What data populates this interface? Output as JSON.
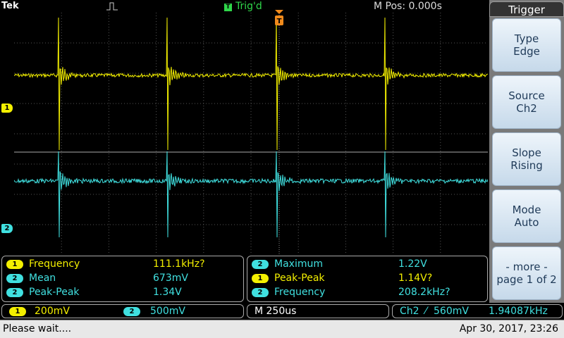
{
  "header": {
    "brand": "Tek",
    "trigger_state_badge": "T",
    "trigger_state": "Trig'd",
    "horizontal_position": "M Pos: 0.000s"
  },
  "screen": {
    "trigger_marker": "T",
    "ch1_marker": "1",
    "ch2_marker": "2"
  },
  "side_menu": {
    "title": "Trigger",
    "buttons": [
      {
        "line1": "Type",
        "line2": "Edge"
      },
      {
        "line1": "Source",
        "line2": "Ch2"
      },
      {
        "line1": "Slope",
        "line2": "Rising"
      },
      {
        "line1": "Mode",
        "line2": "Auto"
      },
      {
        "line1": "- more -",
        "line2": "page 1 of 2"
      }
    ]
  },
  "measurements_left": [
    {
      "ch": "1",
      "name": "Frequency",
      "value": "111.1kHz?"
    },
    {
      "ch": "2",
      "name": "Mean",
      "value": "673mV"
    },
    {
      "ch": "2",
      "name": "Peak-Peak",
      "value": "1.34V"
    }
  ],
  "measurements_right": [
    {
      "ch": "2",
      "name": "Maximum",
      "value": "1.22V"
    },
    {
      "ch": "1",
      "name": "Peak-Peak",
      "value": "1.14V?"
    },
    {
      "ch": "2",
      "name": "Frequency",
      "value": "208.2kHz?"
    }
  ],
  "bottom": {
    "ch1_badge": "1",
    "ch1_scale": "200mV",
    "ch2_badge": "2",
    "ch2_scale": "500mV",
    "timebase": "M 250us",
    "trigger_source": "Ch2",
    "trigger_slope_symbol": "⁄",
    "trigger_level": "560mV",
    "trigger_frequency": "1.94087kHz"
  },
  "status": {
    "message": "Please wait....",
    "datetime": "Apr 30, 2017, 23:26"
  },
  "colors": {
    "ch1": "#f4f000",
    "ch2": "#40e0e0",
    "trigger": "#f08a1c"
  }
}
